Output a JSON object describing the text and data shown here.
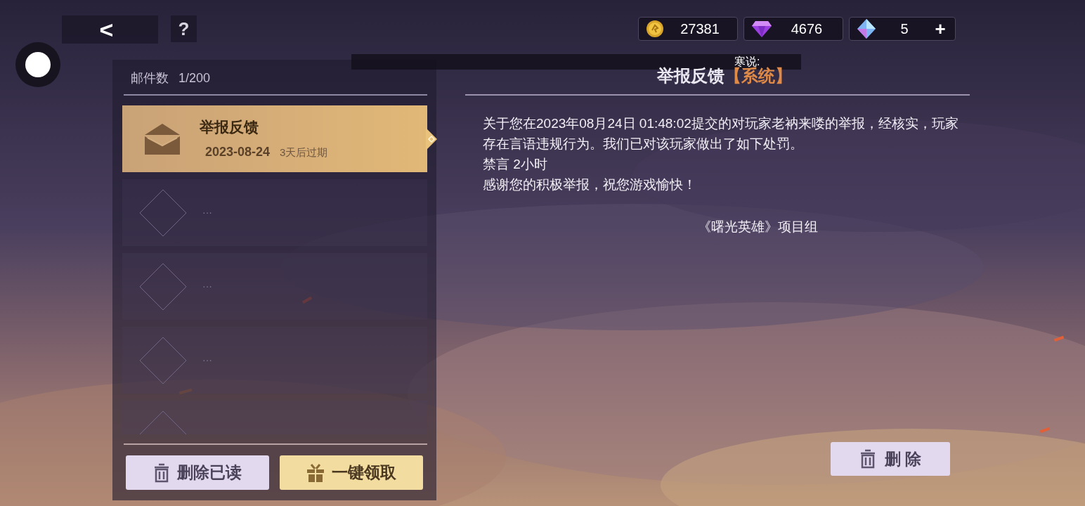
{
  "top_bar": {
    "back": "<",
    "help": "?"
  },
  "currencies": [
    {
      "kind": "coin",
      "amount": "27381"
    },
    {
      "kind": "gem",
      "amount": "4676"
    },
    {
      "kind": "crystal",
      "amount": "5",
      "add": "+"
    }
  ],
  "banner": {
    "text": "寒说:"
  },
  "mail_list": {
    "label": "邮件数",
    "count": "1/200",
    "items": [
      {
        "kind": "mail",
        "title": "举报反馈",
        "date": "2023-08-24",
        "expiry": "3天后过期",
        "selected": true
      },
      {
        "kind": "empty",
        "label": "···",
        "selected": false
      },
      {
        "kind": "empty",
        "label": "···",
        "selected": false
      },
      {
        "kind": "empty",
        "label": "···",
        "selected": false
      },
      {
        "kind": "empty",
        "selected": false
      }
    ],
    "buttons": [
      {
        "kind": "delete",
        "label": "删除已读"
      },
      {
        "kind": "claim",
        "label": "一键领取"
      }
    ]
  },
  "mail_detail": {
    "title": "举报反馈",
    "tag": "【系统】",
    "paragraphs": [
      "关于您在2023年08月24日 01:48:02提交的对玩家老衲来喽的举报，经核实，玩家存在言语违规行为。我们已对该玩家做出了如下处罚。",
      "禁言 2小时",
      "感谢您的积极举报，祝您游戏愉快！"
    ],
    "signature": "《曙光英雄》项目组",
    "delete_button": "删 除"
  }
}
